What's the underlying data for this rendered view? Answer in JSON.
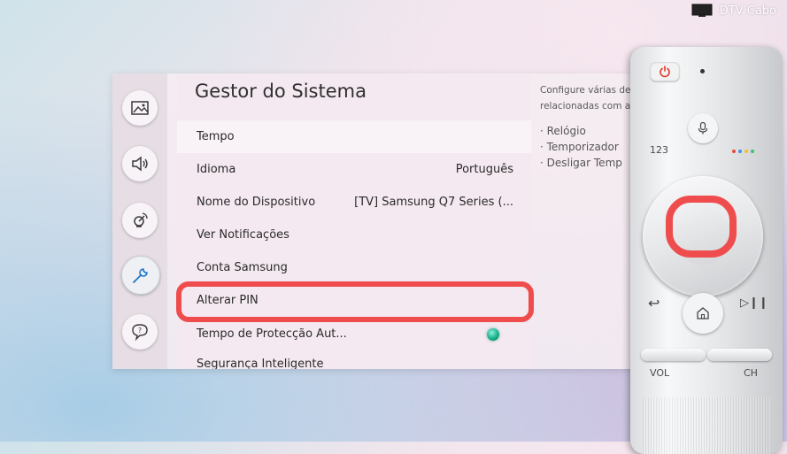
{
  "source": {
    "label": "DTV Cabo",
    "icon": "tv-icon"
  },
  "sidebar": {
    "items": [
      {
        "name": "picture-icon"
      },
      {
        "name": "sound-icon"
      },
      {
        "name": "broadcast-icon"
      },
      {
        "name": "wrench-icon",
        "active": true
      },
      {
        "name": "support-icon"
      }
    ]
  },
  "menu": {
    "title": "Gestor do Sistema",
    "items": [
      {
        "label": "Tempo",
        "value": ""
      },
      {
        "label": "Idioma",
        "value": "Português"
      },
      {
        "label": "Nome do Dispositivo",
        "value": "[TV] Samsung Q7 Series (..."
      },
      {
        "label": "Ver Notificações",
        "value": ""
      },
      {
        "label": "Conta Samsung",
        "value": ""
      },
      {
        "label": "Alterar PIN",
        "value": ""
      },
      {
        "label": "Tempo de Protecção Aut...",
        "value": ""
      },
      {
        "label": "Segurança Inteligente",
        "value": ""
      }
    ]
  },
  "info": {
    "line1": "Configure várias defi",
    "line2": "relacionadas com a he",
    "bullets": [
      "· Relógio",
      "· Temporizador",
      "· Desligar Temp"
    ]
  },
  "remote": {
    "number_label": "123",
    "vol_label": "VOL",
    "ch_label": "CH",
    "back_icon": "↩",
    "play_icon": "▷❙❙",
    "dot_colors": [
      "#e84a3c",
      "#4a8fe8",
      "#f2c12e",
      "#3cc46a"
    ]
  },
  "colors": {
    "highlight": "#ef4d4d",
    "toggle": "#17b08b"
  }
}
